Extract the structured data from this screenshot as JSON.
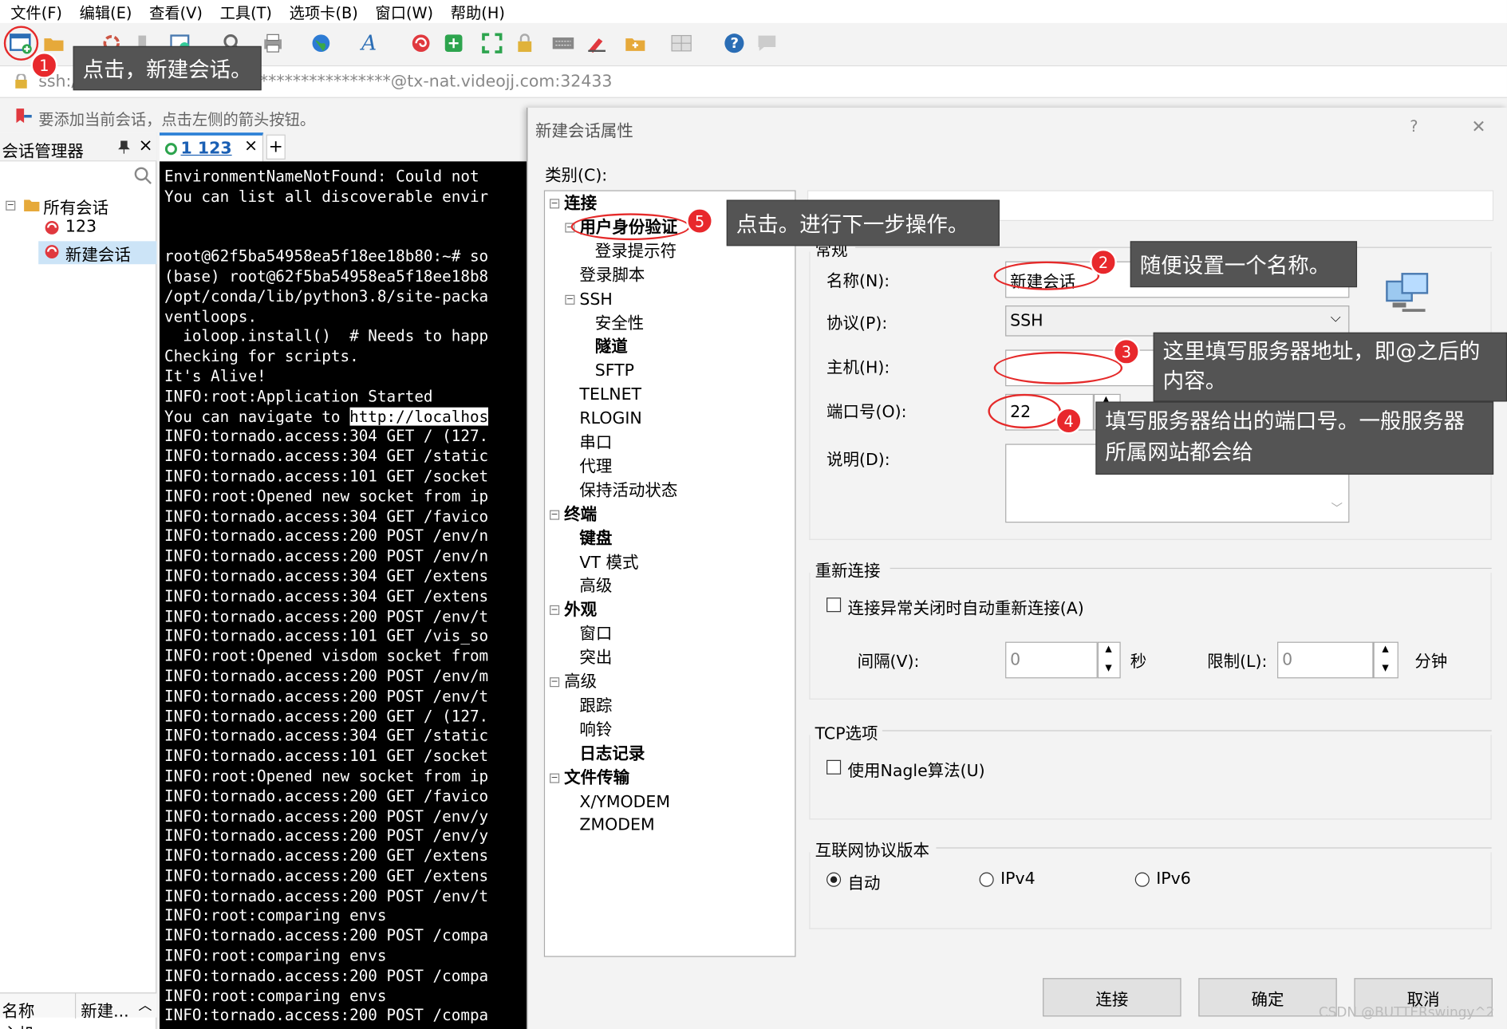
{
  "menu": [
    "文件(F)",
    "编辑(E)",
    "查看(V)",
    "工具(T)",
    "选项卡(B)",
    "窗口(W)",
    "帮助(H)"
  ],
  "address": "ssh://root:*****************@tx-nat.videojj.com:32433",
  "address_visible": "ssh://root:",
  "address_suffix": "*****************@tx-nat.videojj.com:32433",
  "hint": "要添加当前会话，点击左侧的箭头按钮。",
  "session_manager": {
    "title": "会话管理器",
    "pin": " ",
    "close": "×",
    "tree": [
      {
        "label": "所有会话"
      },
      {
        "label": "123"
      },
      {
        "label": "新建会话"
      }
    ],
    "props_header": [
      "名称",
      "新建..."
    ],
    "props_row": "主机"
  },
  "tab": {
    "label": "1 123",
    "close": "×",
    "add": "+"
  },
  "terminal_lines": [
    "EnvironmentNameNotFound: Could not",
    "You can list all discoverable envir",
    "",
    "",
    "root@62f5ba54958ea5f18ee18b80:~# so",
    "(base) root@62f5ba54958ea5f18ee18b8",
    "/opt/conda/lib/python3.8/site-packa",
    "ventloops.",
    "  ioloop.install()  # Needs to happ",
    "Checking for scripts.",
    "It's Alive!",
    "INFO:root:Application Started",
    "You can navigate to http://localhos",
    "INFO:tornado.access:304 GET / (127.",
    "INFO:tornado.access:304 GET /static",
    "INFO:tornado.access:101 GET /socket",
    "INFO:root:Opened new socket from ip",
    "INFO:tornado.access:304 GET /favico",
    "INFO:tornado.access:200 POST /env/n",
    "INFO:tornado.access:200 POST /env/n",
    "INFO:tornado.access:304 GET /extens",
    "INFO:tornado.access:304 GET /extens",
    "INFO:tornado.access:200 POST /env/t",
    "INFO:tornado.access:101 GET /vis_so",
    "INFO:root:Opened visdom socket from",
    "INFO:tornado.access:200 POST /env/m",
    "INFO:tornado.access:200 POST /env/t",
    "INFO:tornado.access:200 GET / (127.",
    "INFO:tornado.access:304 GET /static",
    "INFO:tornado.access:101 GET /socket",
    "INFO:root:Opened new socket from ip",
    "INFO:tornado.access:200 GET /favico",
    "INFO:tornado.access:200 POST /env/y",
    "INFO:tornado.access:200 POST /env/y",
    "INFO:tornado.access:200 GET /extens",
    "INFO:tornado.access:200 GET /extens",
    "INFO:tornado.access:200 POST /env/t",
    "INFO:root:comparing envs",
    "INFO:tornado.access:200 POST /compa",
    "INFO:root:comparing envs",
    "INFO:tornado.access:200 POST /compa",
    "INFO:root:comparing envs",
    "INFO:tornado.access:200 POST /compa"
  ],
  "dialog": {
    "title": "新建会话属性",
    "help": "?",
    "close": "✕",
    "category_label": "类别(C):",
    "tree": [
      {
        "label": "连接",
        "bold": true
      },
      {
        "label": "用户身份验证",
        "bold": true
      },
      {
        "label": "登录提示符",
        "bold": false
      },
      {
        "label": "登录脚本",
        "bold": false
      },
      {
        "label": "SSH",
        "bold": false
      },
      {
        "label": "安全性",
        "bold": false
      },
      {
        "label": "隧道",
        "bold": true
      },
      {
        "label": "SFTP",
        "bold": false
      },
      {
        "label": "TELNET",
        "bold": false
      },
      {
        "label": "RLOGIN",
        "bold": false
      },
      {
        "label": "串口",
        "bold": false
      },
      {
        "label": "代理",
        "bold": false
      },
      {
        "label": "保持活动状态",
        "bold": false
      },
      {
        "label": "终端",
        "bold": true
      },
      {
        "label": "键盘",
        "bold": true
      },
      {
        "label": "VT 模式",
        "bold": false
      },
      {
        "label": "高级",
        "bold": false
      },
      {
        "label": "外观",
        "bold": true
      },
      {
        "label": "窗口",
        "bold": false
      },
      {
        "label": "突出",
        "bold": false
      },
      {
        "label": "高级",
        "bold": false
      },
      {
        "label": "跟踪",
        "bold": false
      },
      {
        "label": "响铃",
        "bold": false
      },
      {
        "label": "日志记录",
        "bold": true
      },
      {
        "label": "文件传输",
        "bold": true
      },
      {
        "label": "X/YMODEM",
        "bold": false
      },
      {
        "label": "ZMODEM",
        "bold": false
      }
    ],
    "section_header": "连接",
    "group_general": "常规",
    "name_label": "名称(N):",
    "name_value": "新建会话",
    "protocol_label": "协议(P):",
    "protocol_value": "SSH",
    "host_label": "主机(H):",
    "host_value": "",
    "port_label": "端口号(O):",
    "port_value": "22",
    "desc_label": "说明(D):",
    "desc_value": "",
    "group_reconnect": "重新连接",
    "reconnect_check": "连接异常关闭时自动重新连接(A)",
    "interval_label": "间隔(V):",
    "interval_value": "0",
    "interval_unit": "秒",
    "limit_label": "限制(L):",
    "limit_value": "0",
    "limit_unit": "分钟",
    "group_tcp": "TCP选项",
    "nagle_check": "使用Nagle算法(U)",
    "group_ip": "互联网协议版本",
    "ip_options": [
      "自动",
      "IPv4",
      "IPv6"
    ],
    "ip_selected": "自动",
    "btn_connect": "连接",
    "btn_ok": "确定",
    "btn_cancel": "取消"
  },
  "annotations": [
    {
      "n": "1",
      "text": "点击，新建会话。"
    },
    {
      "n": "2",
      "text": "随便设置一个名称。"
    },
    {
      "n": "3",
      "text": "这里填写服务器地址，即@之后的内容。"
    },
    {
      "n": "4",
      "text": "填写服务器给出的端口号。一般服务器所属网站都会给"
    },
    {
      "n": "5",
      "text": "点击。进行下一步操作。"
    }
  ],
  "ann3_lines": [
    "这里填写服务器地址，即@之后的",
    "内容。"
  ],
  "ann4_lines": [
    "填写服务器给出的端口号。一般服务器",
    "所属网站都会给"
  ],
  "watermark": "CSDN @BUTTERswingy^2"
}
